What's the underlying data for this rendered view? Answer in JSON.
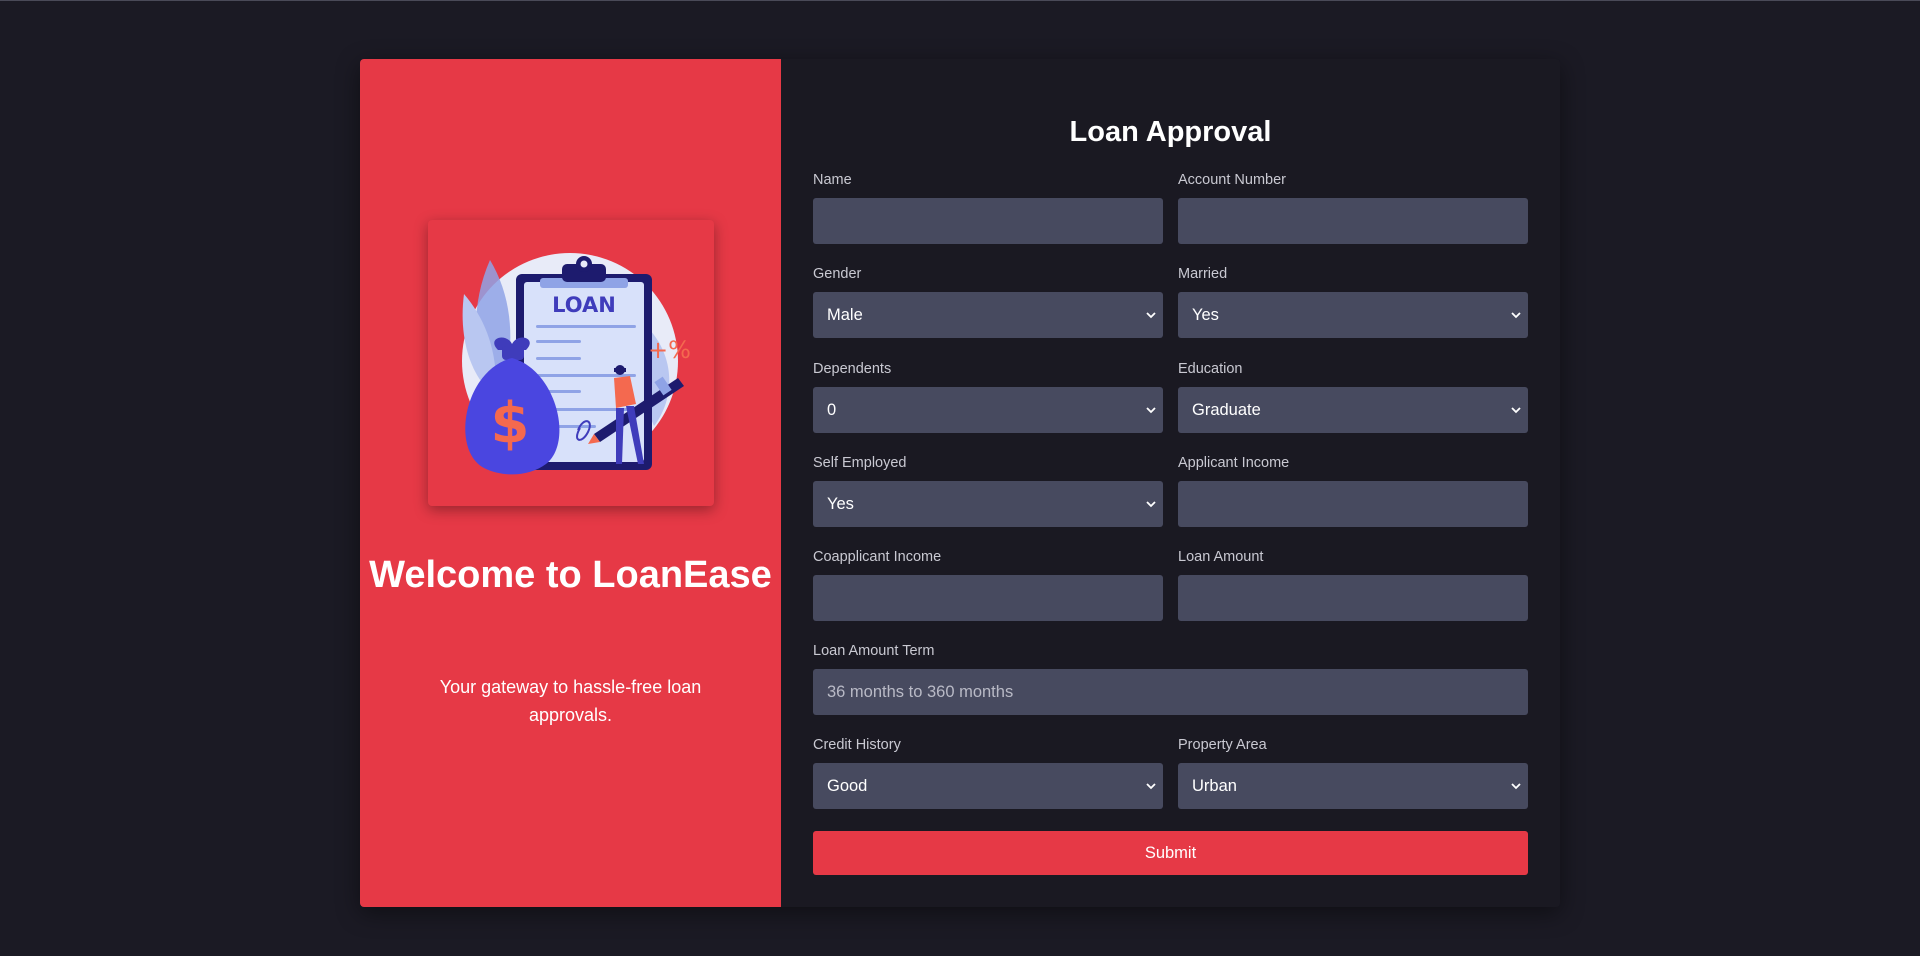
{
  "welcome": {
    "title": "Welcome to LoanEase",
    "subtitle": "Your gateway to hassle-free loan approvals.",
    "illustration_text": "LOAN",
    "illustration_percent": "+%",
    "illustration_currency": "$"
  },
  "form": {
    "title": "Loan Approval",
    "fields": {
      "name": {
        "label": "Name",
        "value": "",
        "placeholder": ""
      },
      "account_number": {
        "label": "Account Number",
        "value": "",
        "placeholder": ""
      },
      "gender": {
        "label": "Gender",
        "selected": "Male"
      },
      "married": {
        "label": "Married",
        "selected": "Yes"
      },
      "dependents": {
        "label": "Dependents",
        "selected": "0"
      },
      "education": {
        "label": "Education",
        "selected": "Graduate"
      },
      "self_employed": {
        "label": "Self Employed",
        "selected": "Yes"
      },
      "applicant_income": {
        "label": "Applicant Income",
        "value": "",
        "placeholder": ""
      },
      "coapplicant_income": {
        "label": "Coapplicant Income",
        "value": "",
        "placeholder": ""
      },
      "loan_amount": {
        "label": "Loan Amount",
        "value": "",
        "placeholder": ""
      },
      "loan_amount_term": {
        "label": "Loan Amount Term",
        "value": "",
        "placeholder": "36 months to 360 months"
      },
      "credit_history": {
        "label": "Credit History",
        "selected": "Good"
      },
      "property_area": {
        "label": "Property Area",
        "selected": "Urban"
      }
    },
    "submit_label": "Submit"
  },
  "icons": {
    "select_chevron": "chevron-down-icon",
    "illustration": "loan-clipboard-illustration"
  },
  "colors": {
    "page_background": "#1b1a24",
    "accent": "#e63946",
    "input_background": "#474a5f",
    "form_background": "#1a1922"
  }
}
